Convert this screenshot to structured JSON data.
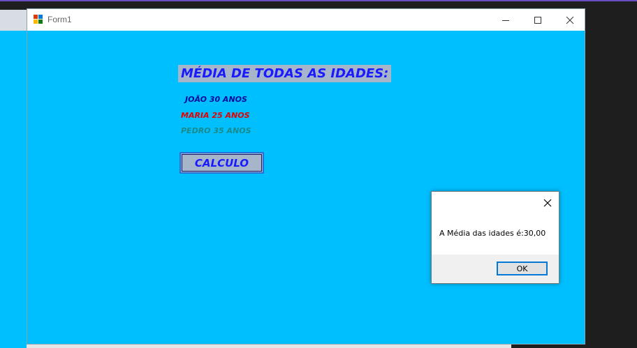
{
  "window": {
    "title": "Form1",
    "background": "#00bfff",
    "icon": "winforms-app-icon",
    "controls": {
      "minimize": "minimize-icon",
      "maximize": "maximize-icon",
      "close": "close-icon"
    }
  },
  "form": {
    "heading": "MÉDIA DE TODAS AS IDADES:",
    "labels": [
      {
        "text": "JOÃO 30 ANOS",
        "color": "#0a0a9c"
      },
      {
        "text": "MARIA 25 ANOS",
        "color": "#e60000"
      },
      {
        "text": "PEDRO 35 ANOS",
        "color": "#1a8a8a"
      }
    ],
    "calc_button": "CALCULO"
  },
  "messagebox": {
    "message": "A Média das idades é:30,00",
    "ok_label": "OK",
    "accent": "#0078d7"
  }
}
